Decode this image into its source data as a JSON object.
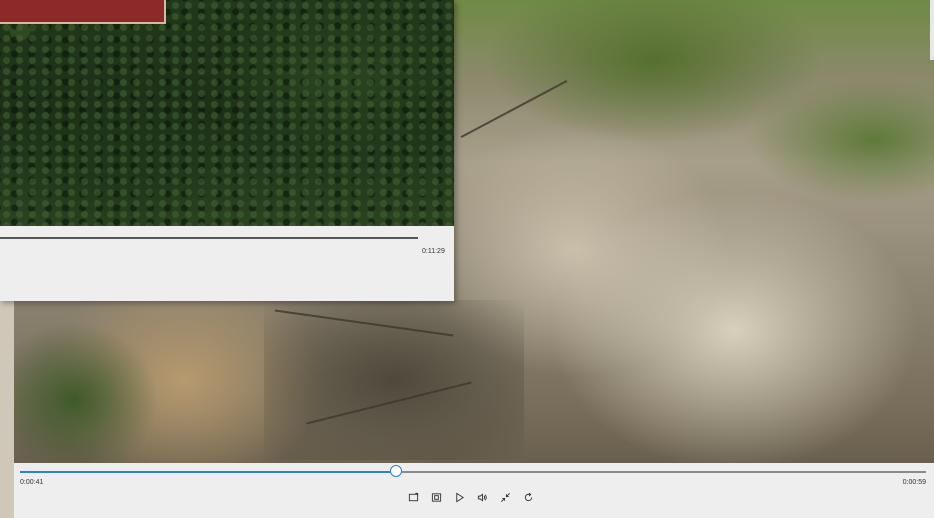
{
  "players": {
    "back": {
      "elapsed": "0:00:41",
      "duration": "0:00:59",
      "progress": 0.415,
      "accent_color": "#2f7fd6",
      "buttons": [
        {
          "name": "cast-icon"
        },
        {
          "name": "miniplayer-icon"
        },
        {
          "name": "play-icon"
        },
        {
          "name": "volume-icon"
        },
        {
          "name": "collapse-icon"
        },
        {
          "name": "repeat-icon"
        }
      ]
    },
    "front": {
      "duration": "0:11:29"
    }
  }
}
